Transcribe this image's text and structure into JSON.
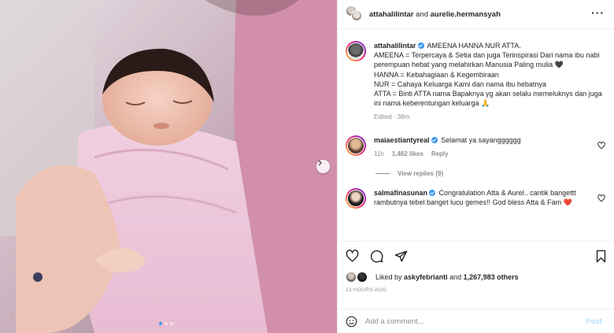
{
  "header": {
    "username_1": "attahalilintar",
    "joiner": "and",
    "username_2": "aurelie.hermansyah",
    "more_icon": "more-horizontal-icon"
  },
  "caption": {
    "username": "attahalilintar",
    "text_1": "AMEENA HANNA NUR ATTA.",
    "text_2": "AMEENA = Terpercaya & Setia dan juga Terinspirasi Dari nama ibu nabi perempuan hebat yang melahirkan Manusia Paling mulia 🖤",
    "text_3": "HANNA = Kebahagiaan & Kegembiraan",
    "text_4": "NUR = Cahaya Keluarga Kami dan nama ibu hebatnya",
    "text_5": "ATTA = Binti ATTA nama Bapaknya yg akan selalu memeluknys dan juga ini nama keberentungan keluarga 🙏",
    "edited": "Edited",
    "time": "38m"
  },
  "comments": [
    {
      "username": "maiaestiantyreal",
      "verified": true,
      "text": "Selamat ya sayangggggg",
      "time": "11h",
      "likes": "1,462 likes",
      "reply": "Reply"
    },
    {
      "username": "salmafinasunan",
      "verified": true,
      "text": "Congratulation Atta & Aurel.. cantik bangettt rambutnya tebel banget lucu gemes!! God bless Atta & Fam ❤️"
    }
  ],
  "view_replies": "View replies (9)",
  "likes": {
    "prefix": "Liked by",
    "user": "askyfebrianti",
    "and": "and",
    "others": "1,267,983 others"
  },
  "timeago": "13 HOURS AGO",
  "add_comment": {
    "placeholder": "Add a comment...",
    "post": "Post"
  },
  "carousel": {
    "slides": 3,
    "active": 1
  },
  "colors": {
    "accent": "#3897f0",
    "post_disabled": "#b2dffc",
    "muted": "#8e8e8e"
  }
}
